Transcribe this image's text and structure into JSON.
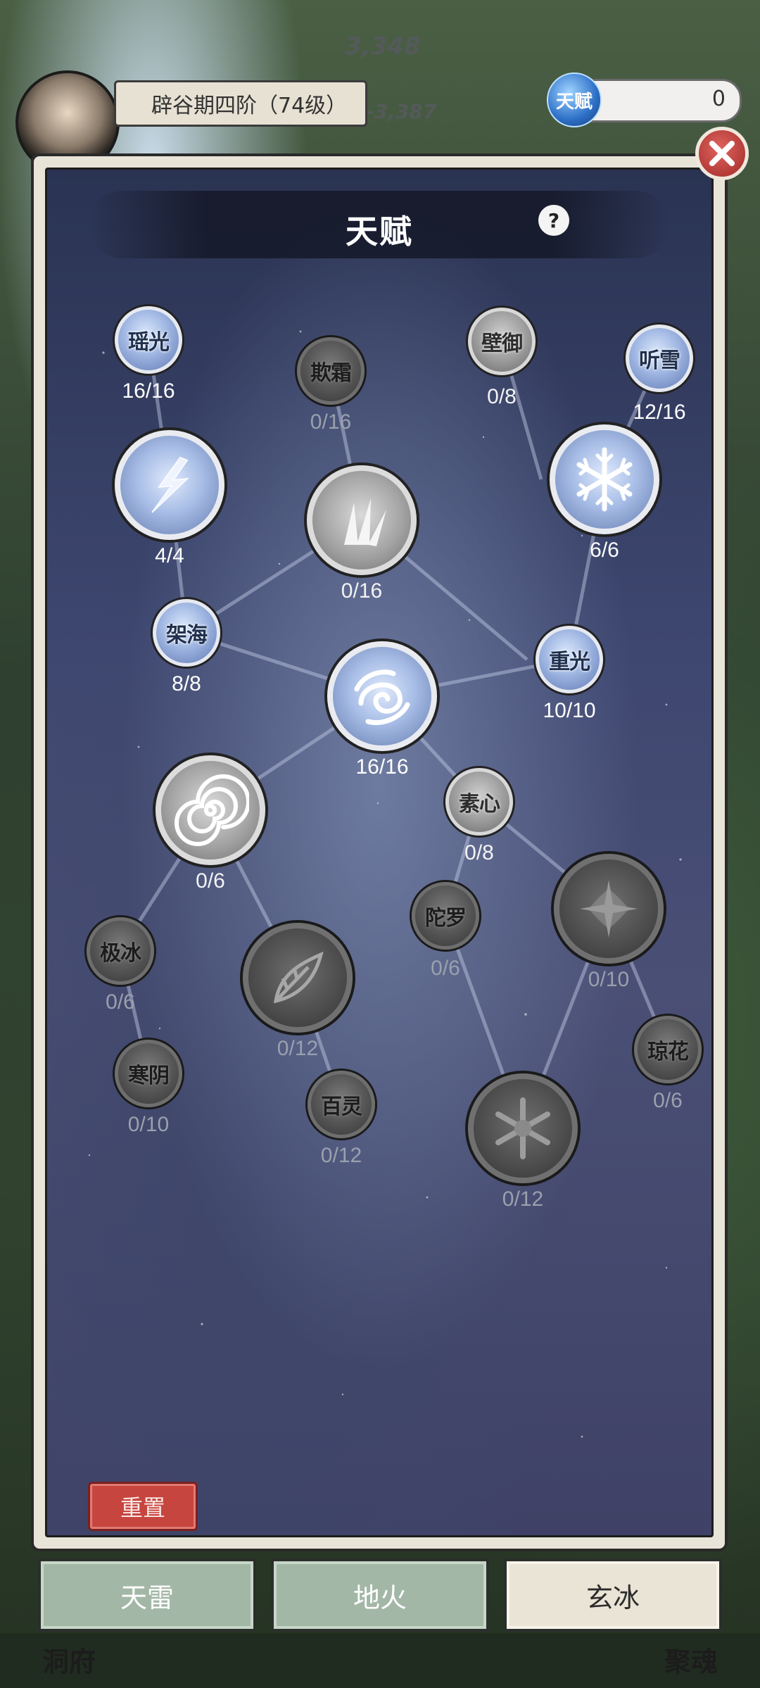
{
  "player": {
    "realm": "辟谷期四阶（74级）"
  },
  "talent_points": {
    "badge": "天赋",
    "value": "0"
  },
  "panel": {
    "title": "天赋",
    "help": "?",
    "reset_label": "重置"
  },
  "nodes": [
    {
      "label": "瑶光",
      "count": "16/16",
      "state": "active",
      "size": "small",
      "icon": ""
    },
    {
      "label": "欺霜",
      "count": "0/16",
      "state": "locked",
      "size": "small",
      "icon": ""
    },
    {
      "label": "壁御",
      "count": "0/8",
      "state": "half",
      "size": "small",
      "icon": ""
    },
    {
      "label": "听雪",
      "count": "12/16",
      "state": "active",
      "size": "small",
      "icon": ""
    },
    {
      "label": "",
      "count": "4/4",
      "state": "active",
      "size": "big",
      "icon": "lightning-icon"
    },
    {
      "label": "",
      "count": "0/16",
      "state": "half",
      "size": "big",
      "icon": "ice-shards-icon"
    },
    {
      "label": "",
      "count": "6/6",
      "state": "active",
      "size": "big",
      "icon": "snowflake-icon"
    },
    {
      "label": "架海",
      "count": "8/8",
      "state": "active",
      "size": "small",
      "icon": ""
    },
    {
      "label": "",
      "count": "16/16",
      "state": "active",
      "size": "big",
      "icon": "swirl-icon"
    },
    {
      "label": "重光",
      "count": "10/10",
      "state": "active",
      "size": "small",
      "icon": ""
    },
    {
      "label": "",
      "count": "0/6",
      "state": "half",
      "size": "big",
      "icon": "vortex-icon"
    },
    {
      "label": "素心",
      "count": "0/8",
      "state": "half",
      "size": "small",
      "icon": ""
    },
    {
      "label": "极冰",
      "count": "0/6",
      "state": "locked",
      "size": "small",
      "icon": ""
    },
    {
      "label": "陀罗",
      "count": "0/6",
      "state": "locked",
      "size": "small",
      "icon": ""
    },
    {
      "label": "",
      "count": "0/10",
      "state": "locked",
      "size": "big",
      "icon": "ice-star-icon"
    },
    {
      "label": "",
      "count": "0/12",
      "state": "locked",
      "size": "big",
      "icon": "frost-leaf-icon"
    },
    {
      "label": "寒阴",
      "count": "0/10",
      "state": "locked",
      "size": "small",
      "icon": ""
    },
    {
      "label": "琼花",
      "count": "0/6",
      "state": "locked",
      "size": "small",
      "icon": ""
    },
    {
      "label": "百灵",
      "count": "0/12",
      "state": "locked",
      "size": "small",
      "icon": ""
    },
    {
      "label": "",
      "count": "0/12",
      "state": "locked",
      "size": "big",
      "icon": "frost-flower-icon"
    }
  ],
  "tabs": [
    {
      "label": "天雷",
      "selected": false
    },
    {
      "label": "地火",
      "selected": false
    },
    {
      "label": "玄冰",
      "selected": true
    }
  ],
  "background": {
    "damage_numbers": [
      "3,348",
      "-3,387"
    ],
    "nav_left": "洞府",
    "nav_right": "聚魂"
  },
  "colors": {
    "active_node": "#a7bde6",
    "locked_node": "#4c4c4c",
    "reset_button": "#c7453f",
    "selected_tab": "#eae4d6",
    "inactive_tab": "#a3b7a6"
  }
}
